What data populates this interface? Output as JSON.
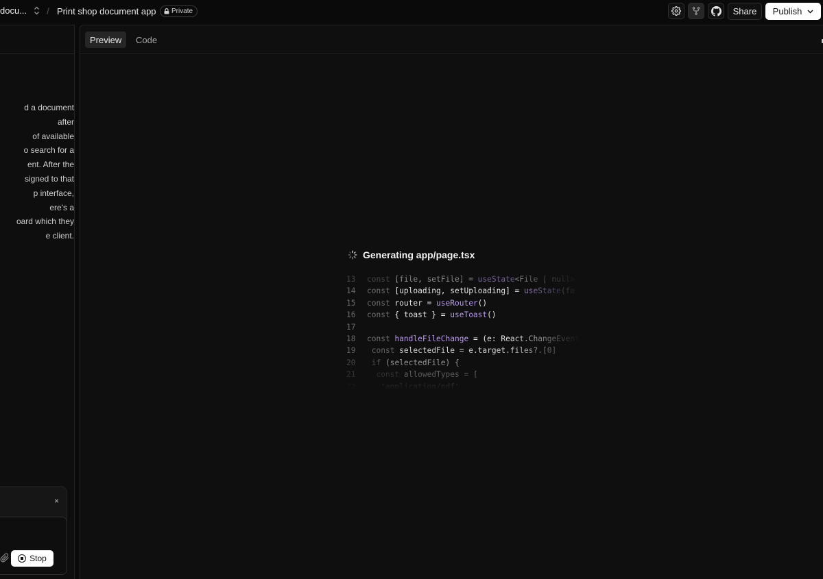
{
  "topbar": {
    "project_short": "docu...",
    "separator": "/",
    "project_title": "Print shop document app",
    "visibility": "Private",
    "share_label": "Share",
    "publish_label": "Publish",
    "icons": [
      "gear-icon",
      "fork-icon",
      "github-icon",
      "chevron-down-icon"
    ]
  },
  "chat": {
    "lines": [
      "d a document",
      "after",
      "of available",
      "o search for a",
      "ent. After the",
      "signed to that",
      "p interface,",
      "ere's a",
      "oard which they",
      "e client."
    ],
    "close_glyph": "×",
    "stop_label": "Stop"
  },
  "preview": {
    "tabs": [
      {
        "label": "Preview",
        "selected": true
      },
      {
        "label": "Code",
        "selected": false
      }
    ],
    "generating_label": "Generating app/page.tsx",
    "code_lines": [
      {
        "n": "13",
        "text": "const [file, setFile] = useState<File | null>"
      },
      {
        "n": "14",
        "text": "const [uploading, setUploading] = useState(fa"
      },
      {
        "n": "15",
        "text": "const router = useRouter()"
      },
      {
        "n": "16",
        "text": "const { toast } = useToast()"
      },
      {
        "n": "17",
        "text": ""
      },
      {
        "n": "18",
        "text": "const handleFileChange = (e: React.ChangeEvent"
      },
      {
        "n": "19",
        "text": " const selectedFile = e.target.files?.[0]"
      },
      {
        "n": "20",
        "text": " if (selectedFile) {"
      },
      {
        "n": "21",
        "text": "  const allowedTypes = ["
      },
      {
        "n": "22",
        "text": "   'application/pdf',"
      }
    ]
  },
  "colors": {
    "background": "#0a0a0a",
    "panel": "#0f0f0f",
    "accent_purple": "#b99af0",
    "button_light": "#ffffff"
  }
}
